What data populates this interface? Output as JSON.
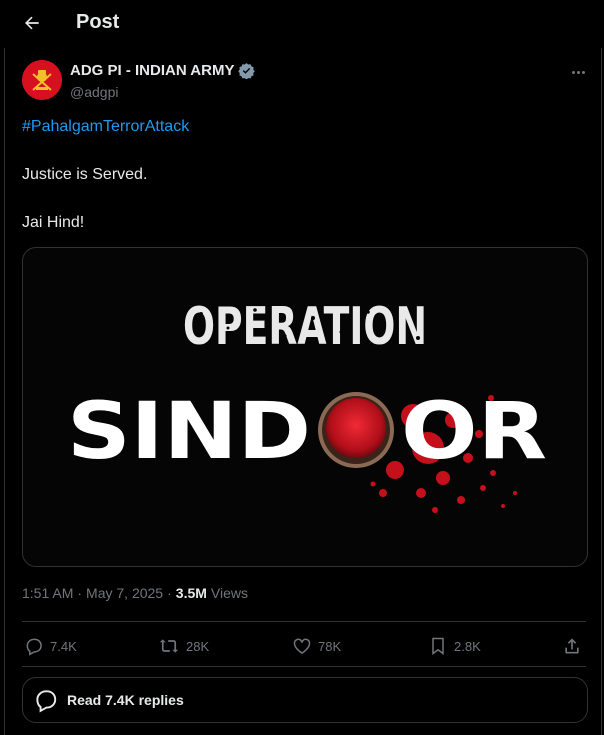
{
  "header": {
    "title": "Post"
  },
  "author": {
    "name": "ADG PI - INDIAN ARMY",
    "handle": "@adgpi"
  },
  "post": {
    "hashtag": "#PahalgamTerrorAttack",
    "line1": "Justice is Served.",
    "line2": "Jai Hind!"
  },
  "media": {
    "word_top": "OPERATION",
    "word_left": "SIND",
    "word_right": "OR"
  },
  "meta": {
    "time": "1:51 AM",
    "date": "May 7, 2025",
    "views": "3.5M",
    "views_label": "Views",
    "sep": "·"
  },
  "actions": {
    "replies": "7.4K",
    "reposts": "28K",
    "likes": "78K",
    "bookmarks": "2.8K"
  },
  "replies_button": {
    "label": "Read 7.4K replies"
  },
  "colors": {
    "accent": "#1d9bf0",
    "text": "#e7e9ea",
    "muted": "#71767b",
    "border": "#2f3336",
    "verified": "#829aab",
    "sindoor_red": "#d0141e"
  }
}
